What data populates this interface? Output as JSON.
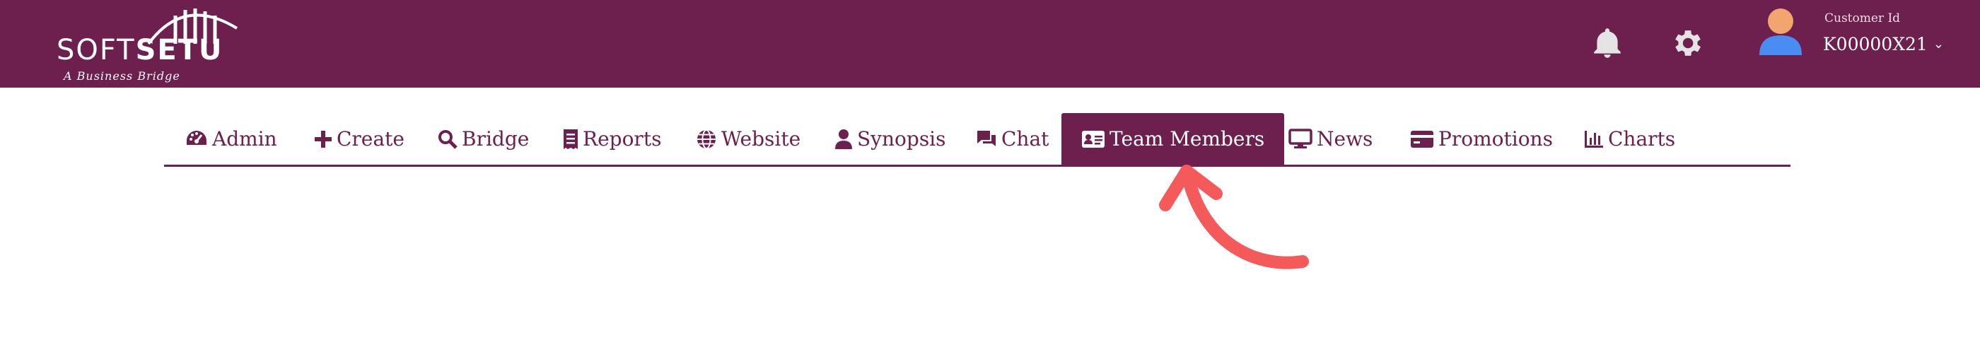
{
  "header": {
    "logo": {
      "word_light": "SOFT",
      "word_bold": "SETU",
      "tagline": "A Business Bridge"
    },
    "icons": [
      "bell-icon",
      "gear-icon",
      "user-avatar-icon"
    ],
    "customer_label": "Customer Id",
    "customer_id": "K00000X21",
    "dropdown_glyph": "⌄"
  },
  "nav": {
    "tabs": [
      {
        "label": "Admin",
        "icon": "dashboard-icon"
      },
      {
        "label": "Create",
        "icon": "plus-icon"
      },
      {
        "label": "Bridge",
        "icon": "search-icon"
      },
      {
        "label": "Reports",
        "icon": "receipt-icon"
      },
      {
        "label": "Website",
        "icon": "globe-icon"
      },
      {
        "label": "Synopsis",
        "icon": "user-icon"
      },
      {
        "label": "Chat",
        "icon": "chat-icon"
      },
      {
        "label": "Team Members",
        "icon": "id-card-icon",
        "active": true
      },
      {
        "label": "News",
        "icon": "monitor-icon"
      },
      {
        "label": "Promotions",
        "icon": "credit-card-icon"
      },
      {
        "label": "Charts",
        "icon": "bar-chart-icon"
      }
    ]
  },
  "colors": {
    "brand": "#6d1f4e",
    "accent_arrow": "#f45a5a",
    "text_on_brand": "#ffffff"
  }
}
